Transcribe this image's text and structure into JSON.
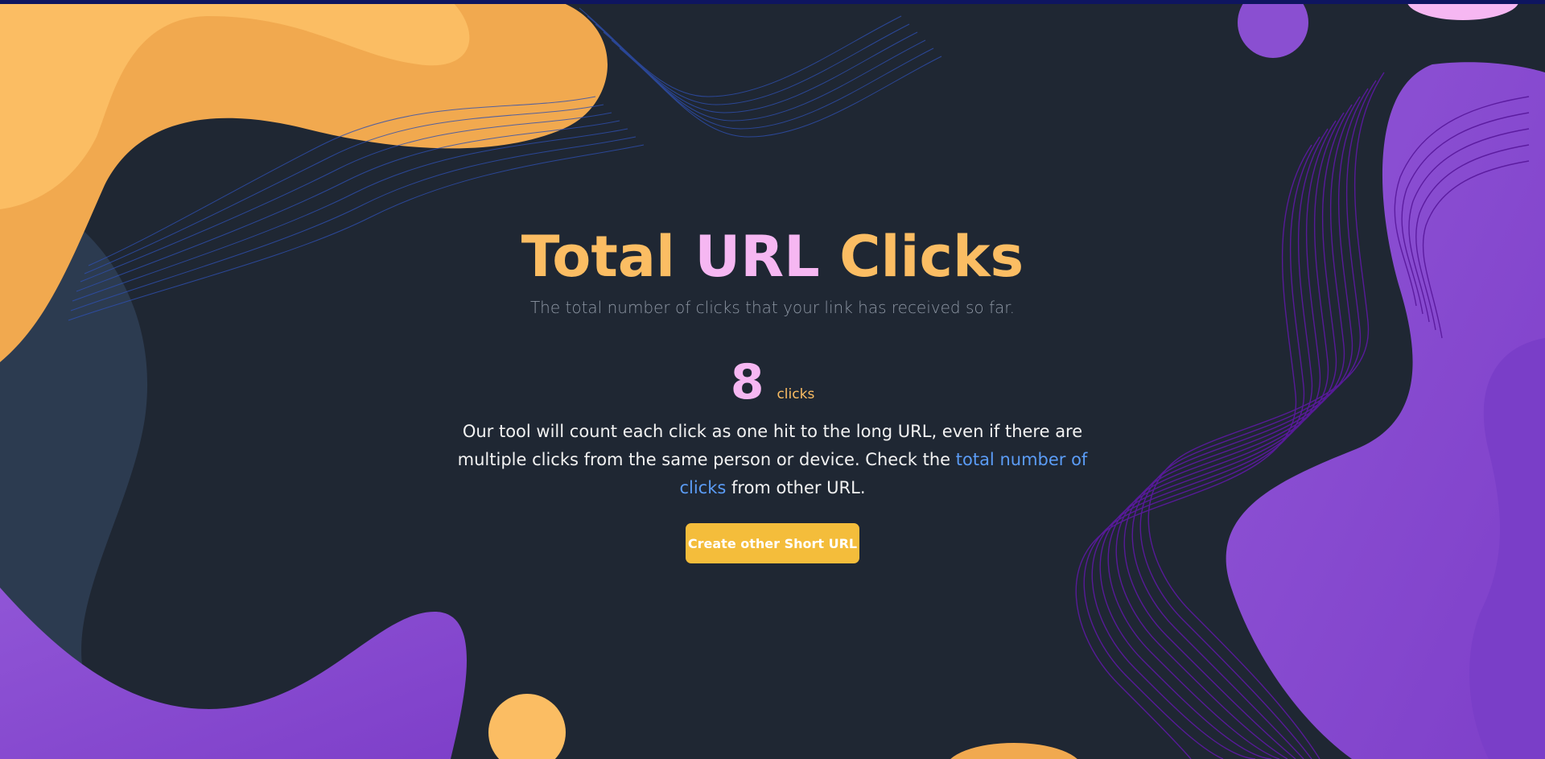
{
  "hero": {
    "title_part1": "Total",
    "title_part2": "URL",
    "title_part3": "Clicks",
    "subtitle": "The total number of clicks that your link has received so far."
  },
  "stats": {
    "click_count": "8",
    "click_unit": "clicks"
  },
  "description": {
    "text_before": "Our tool will count each click as one hit to the long URL, even if there are multiple clicks from the same person or device. Check the",
    "link_text": "total number of clicks",
    "text_after": "from other URL."
  },
  "actions": {
    "create_button_label": "Create other Short URL"
  },
  "colors": {
    "background": "#1f2733",
    "accent_orange": "#fbbd63",
    "accent_pink": "#f6b7f2",
    "accent_purple": "#8a4fd1",
    "link_blue": "#5b9cf6",
    "button_yellow": "#f4bd3b",
    "top_bar": "#0e1560"
  }
}
